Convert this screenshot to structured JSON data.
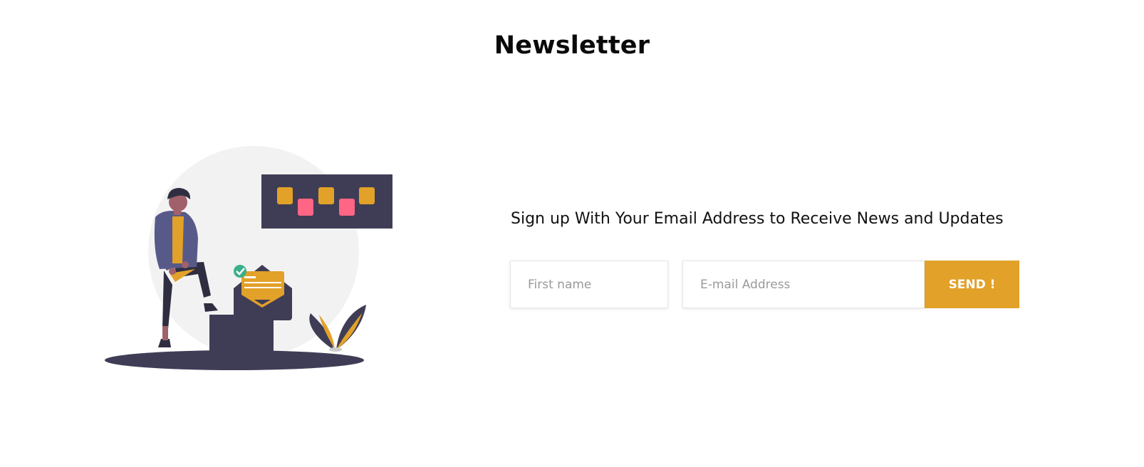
{
  "section": {
    "title": "Newsletter"
  },
  "illustration": {
    "icon": "newsletter-illustration",
    "colors": {
      "circle": "#f2f2f2",
      "dark": "#3f3d56",
      "accent": "#e2a128",
      "pink": "#ff6584",
      "shirt": "#575a89",
      "skin": "#a0616a",
      "check": "#3ab08a"
    }
  },
  "signup": {
    "heading": "Sign up With Your Email Address to Receive News and Updates",
    "first_name_placeholder": "First name",
    "email_placeholder": "E-mail Address",
    "send_label": "SEND !",
    "button_color": "#e2a128"
  }
}
